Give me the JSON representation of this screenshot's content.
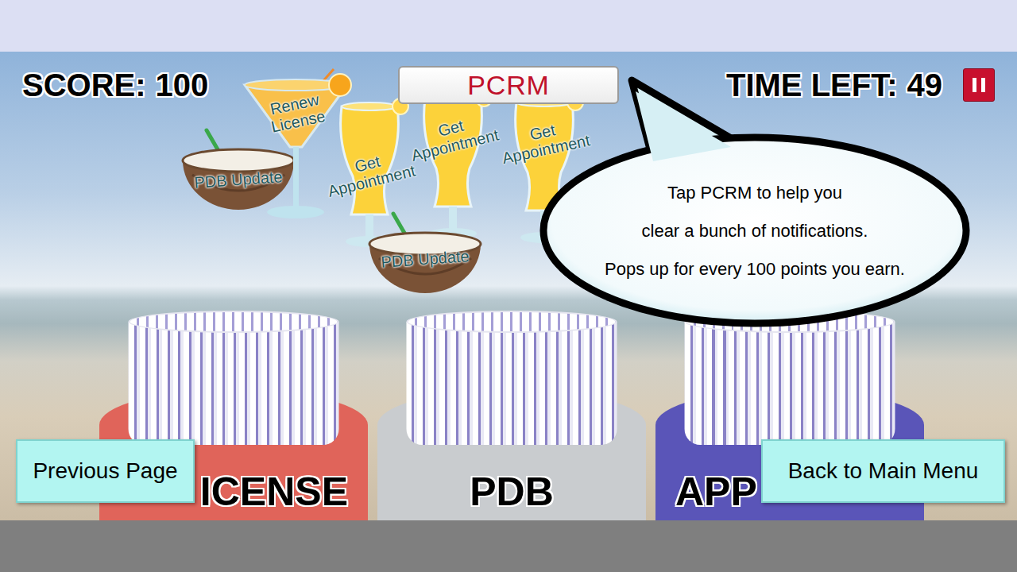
{
  "hud": {
    "score_label": "SCORE:",
    "score": "100",
    "time_label": "TIME LEFT:",
    "time": "49"
  },
  "pcrm_button": {
    "label": "PCRM"
  },
  "notifications": [
    {
      "kind": "coconut",
      "label": "PDB Update"
    },
    {
      "kind": "cocktail",
      "label": "Renew License"
    },
    {
      "kind": "hurricane",
      "label": "Get Appointment"
    },
    {
      "kind": "hurricane",
      "label": "Get Appointment"
    },
    {
      "kind": "coconut",
      "label": "PDB Update"
    },
    {
      "kind": "hurricane",
      "label": "Get Appointment"
    }
  ],
  "tip": {
    "lines": [
      "Tap PCRM to help you",
      "clear a bunch of notifications.",
      "Pops up for every 100 points you earn."
    ]
  },
  "bins": [
    {
      "label": "ICENSE",
      "color": "#e0645a"
    },
    {
      "label": "PDB",
      "color": "#c9cccf"
    },
    {
      "label": "APP",
      "color": "#5a55b8"
    }
  ],
  "nav": {
    "previous": "Previous Page",
    "main_menu": "Back to Main Menu"
  }
}
